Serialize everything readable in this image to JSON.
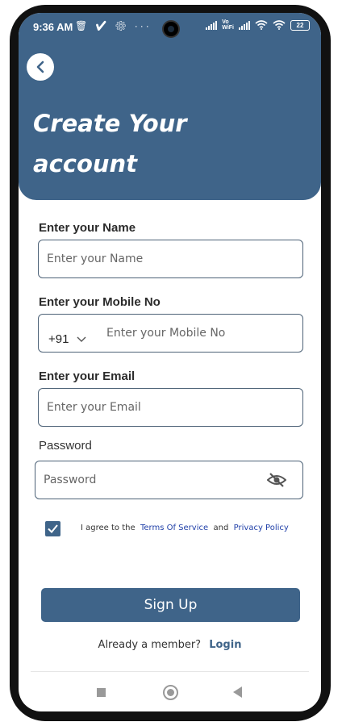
{
  "status_bar": {
    "time": "9:36 AM",
    "notif_icons": "🗑 ✔ ⚙ ···",
    "vowifi_top": "Vo",
    "vowifi_bottom": "WiFi",
    "battery": "22"
  },
  "header": {
    "title_line1": "Create Your",
    "title_line2": "account"
  },
  "form": {
    "name_label": "Enter your Name",
    "name_placeholder": "Enter your Name",
    "mobile_label": "Enter your Mobile No",
    "country_code": "+91",
    "mobile_placeholder": "Enter your Mobile No",
    "email_label": "Enter your Email",
    "email_placeholder": "Enter your Email",
    "password_label": "Password",
    "password_placeholder": "Password"
  },
  "agreement": {
    "prefix": "I agree to the",
    "terms": "Terms Of Service",
    "and": "and",
    "privacy": "Privacy Policy",
    "checked": true
  },
  "actions": {
    "signup_label": "Sign Up",
    "member_text": "Already a member?",
    "login_label": "Login"
  },
  "colors": {
    "primary": "#3f6489",
    "link": "#1f3fa8"
  }
}
